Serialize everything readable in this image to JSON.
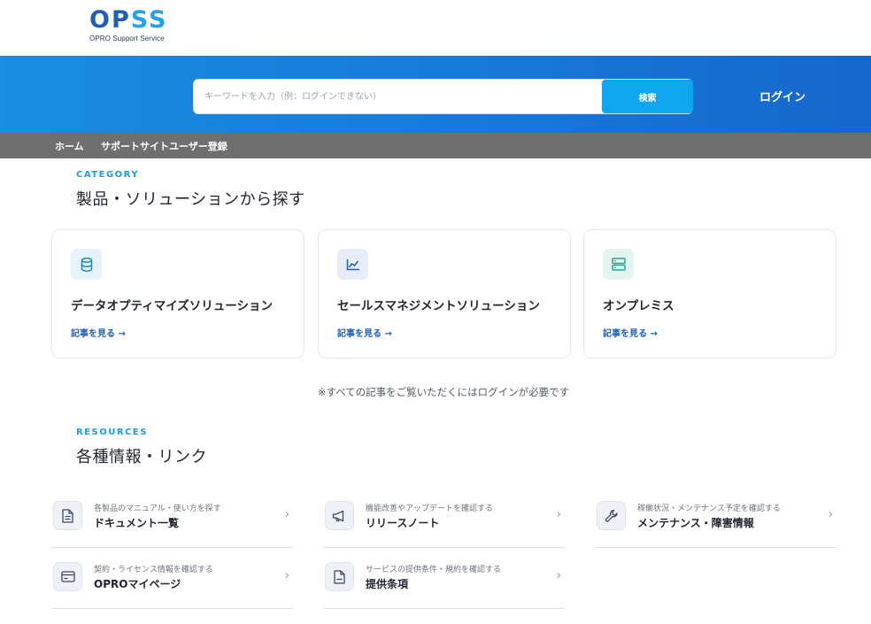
{
  "header": {
    "logo_text": "OPSS",
    "logo_sub": "OPRO Support Service",
    "search_placeholder": "キーワードを入力（例：ログインできない）",
    "search_button": "検索",
    "login": "ログイン"
  },
  "nav": {
    "items": [
      "ホーム",
      "サポートサイトユーザー登録"
    ]
  },
  "category": {
    "eyebrow": "CATEGORY",
    "title": "製品・ソリューションから探す",
    "cards": [
      {
        "name": "データオプティマイズソリューション",
        "link": "記事を見る →",
        "icon": "database-icon"
      },
      {
        "name": "セールスマネジメントソリューション",
        "link": "記事を見る →",
        "icon": "line-chart-icon"
      },
      {
        "name": "オンプレミス",
        "link": "記事を見る →",
        "icon": "server-icon"
      }
    ],
    "note": "※すべての記事をご覧いただくにはログインが必要です"
  },
  "resources": {
    "eyebrow": "RESOURCES",
    "title": "各種情報・リンク",
    "items": [
      {
        "sub": "各製品のマニュアル・使い方を探す",
        "title": "ドキュメント一覧",
        "icon": "document-icon"
      },
      {
        "sub": "機能改善やアップデートを確認する",
        "title": "リリースノート",
        "icon": "megaphone-icon"
      },
      {
        "sub": "稼働状況・メンテナンス予定を確認する",
        "title": "メンテナンス・障害情報",
        "icon": "wrench-icon"
      },
      {
        "sub": "契約・ライセンス情報を確認する",
        "title": "OPROマイページ",
        "icon": "card-icon"
      },
      {
        "sub": "サービスの提供条件・規約を確認する",
        "title": "提供条項",
        "icon": "file-icon"
      }
    ]
  },
  "colors": {
    "brand_blue": "#1f5fb5",
    "accent_cyan": "#0fa6ef",
    "hero_start": "#1a8de0",
    "hero_end": "#1667cc",
    "nav_gray": "#6f6f6f"
  }
}
